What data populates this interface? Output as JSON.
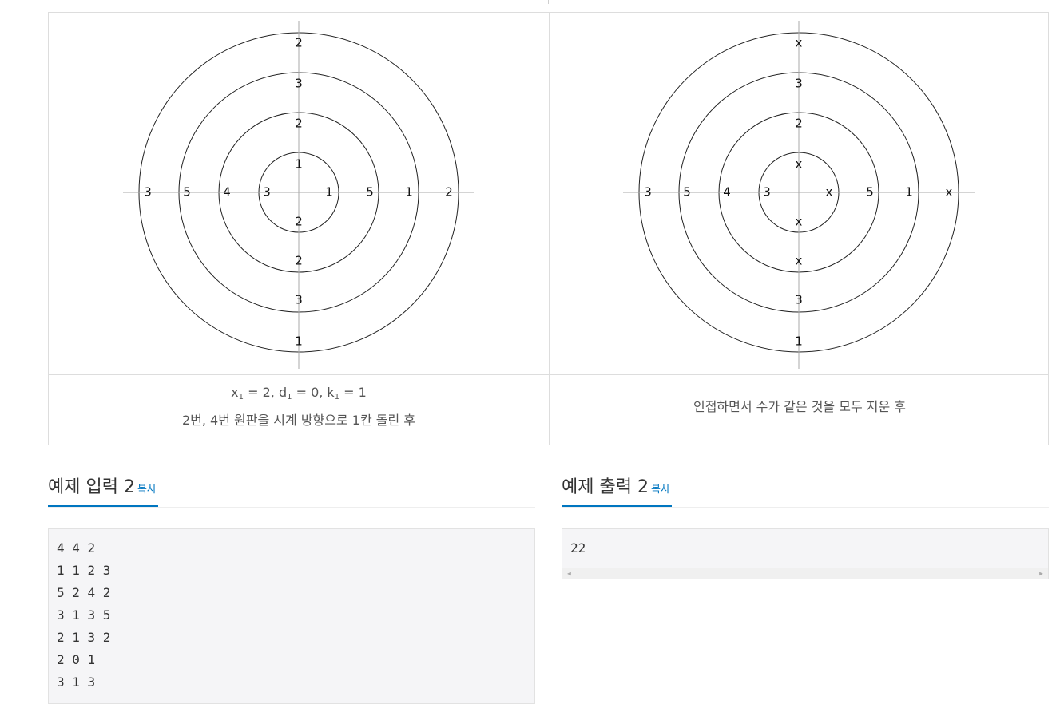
{
  "figures": {
    "left": {
      "top": [
        "2",
        "3",
        "2",
        "1"
      ],
      "bottom": [
        "2",
        "2",
        "3",
        "1"
      ],
      "left": [
        "3",
        "5",
        "4",
        "3"
      ],
      "right": [
        "1",
        "5",
        "1",
        "2"
      ]
    },
    "right": {
      "top": [
        "x",
        "3",
        "2",
        "x"
      ],
      "bottom": [
        "x",
        "x",
        "3",
        "1"
      ],
      "left": [
        "3",
        "5",
        "4",
        "3"
      ],
      "right": [
        "x",
        "5",
        "1",
        "x"
      ]
    }
  },
  "captions": {
    "left": {
      "x": "x",
      "x_sub": "1",
      "x_val": " = 2, ",
      "d": "d",
      "d_sub": "1",
      "d_val": " = 0, ",
      "k": "k",
      "k_sub": "1",
      "k_val": " = 1",
      "line2": "2번, 4번 원판을 시계 방향으로 1칸 돌린 후"
    },
    "right": {
      "line1": "인접하면서 수가 같은 것을 모두 지운 후"
    }
  },
  "sample_input": {
    "title": "예제 입력 2",
    "copy_label": "복사",
    "lines": [
      "4 4 2",
      "1 1 2 3",
      "5 2 4 2",
      "3 1 3 5",
      "2 1 3 2",
      "2 0 1",
      "3 1 3"
    ]
  },
  "sample_output": {
    "title": "예제 출력 2",
    "copy_label": "복사",
    "lines": [
      "22"
    ]
  }
}
